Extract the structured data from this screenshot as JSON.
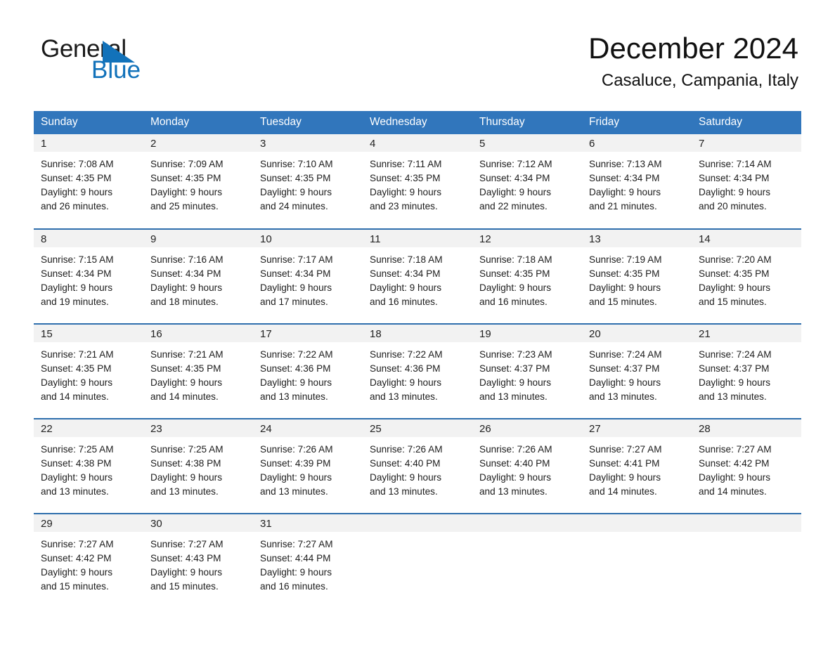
{
  "brand": {
    "name_part1": "General",
    "name_part2": "Blue",
    "logo_icon": "triangle-flag-icon",
    "accent_color": "#1272ba"
  },
  "header": {
    "title": "December 2024",
    "location": "Casaluce, Campania, Italy"
  },
  "theme": {
    "header_blue": "#3176bc",
    "row_divider_blue": "#2f6fad",
    "daynum_band": "#f2f2f2"
  },
  "weekday_headers": [
    "Sunday",
    "Monday",
    "Tuesday",
    "Wednesday",
    "Thursday",
    "Friday",
    "Saturday"
  ],
  "weeks": [
    [
      {
        "day": "1",
        "sunrise": "Sunrise: 7:08 AM",
        "sunset": "Sunset: 4:35 PM",
        "daylight1": "Daylight: 9 hours",
        "daylight2": "and 26 minutes."
      },
      {
        "day": "2",
        "sunrise": "Sunrise: 7:09 AM",
        "sunset": "Sunset: 4:35 PM",
        "daylight1": "Daylight: 9 hours",
        "daylight2": "and 25 minutes."
      },
      {
        "day": "3",
        "sunrise": "Sunrise: 7:10 AM",
        "sunset": "Sunset: 4:35 PM",
        "daylight1": "Daylight: 9 hours",
        "daylight2": "and 24 minutes."
      },
      {
        "day": "4",
        "sunrise": "Sunrise: 7:11 AM",
        "sunset": "Sunset: 4:35 PM",
        "daylight1": "Daylight: 9 hours",
        "daylight2": "and 23 minutes."
      },
      {
        "day": "5",
        "sunrise": "Sunrise: 7:12 AM",
        "sunset": "Sunset: 4:34 PM",
        "daylight1": "Daylight: 9 hours",
        "daylight2": "and 22 minutes."
      },
      {
        "day": "6",
        "sunrise": "Sunrise: 7:13 AM",
        "sunset": "Sunset: 4:34 PM",
        "daylight1": "Daylight: 9 hours",
        "daylight2": "and 21 minutes."
      },
      {
        "day": "7",
        "sunrise": "Sunrise: 7:14 AM",
        "sunset": "Sunset: 4:34 PM",
        "daylight1": "Daylight: 9 hours",
        "daylight2": "and 20 minutes."
      }
    ],
    [
      {
        "day": "8",
        "sunrise": "Sunrise: 7:15 AM",
        "sunset": "Sunset: 4:34 PM",
        "daylight1": "Daylight: 9 hours",
        "daylight2": "and 19 minutes."
      },
      {
        "day": "9",
        "sunrise": "Sunrise: 7:16 AM",
        "sunset": "Sunset: 4:34 PM",
        "daylight1": "Daylight: 9 hours",
        "daylight2": "and 18 minutes."
      },
      {
        "day": "10",
        "sunrise": "Sunrise: 7:17 AM",
        "sunset": "Sunset: 4:34 PM",
        "daylight1": "Daylight: 9 hours",
        "daylight2": "and 17 minutes."
      },
      {
        "day": "11",
        "sunrise": "Sunrise: 7:18 AM",
        "sunset": "Sunset: 4:34 PM",
        "daylight1": "Daylight: 9 hours",
        "daylight2": "and 16 minutes."
      },
      {
        "day": "12",
        "sunrise": "Sunrise: 7:18 AM",
        "sunset": "Sunset: 4:35 PM",
        "daylight1": "Daylight: 9 hours",
        "daylight2": "and 16 minutes."
      },
      {
        "day": "13",
        "sunrise": "Sunrise: 7:19 AM",
        "sunset": "Sunset: 4:35 PM",
        "daylight1": "Daylight: 9 hours",
        "daylight2": "and 15 minutes."
      },
      {
        "day": "14",
        "sunrise": "Sunrise: 7:20 AM",
        "sunset": "Sunset: 4:35 PM",
        "daylight1": "Daylight: 9 hours",
        "daylight2": "and 15 minutes."
      }
    ],
    [
      {
        "day": "15",
        "sunrise": "Sunrise: 7:21 AM",
        "sunset": "Sunset: 4:35 PM",
        "daylight1": "Daylight: 9 hours",
        "daylight2": "and 14 minutes."
      },
      {
        "day": "16",
        "sunrise": "Sunrise: 7:21 AM",
        "sunset": "Sunset: 4:35 PM",
        "daylight1": "Daylight: 9 hours",
        "daylight2": "and 14 minutes."
      },
      {
        "day": "17",
        "sunrise": "Sunrise: 7:22 AM",
        "sunset": "Sunset: 4:36 PM",
        "daylight1": "Daylight: 9 hours",
        "daylight2": "and 13 minutes."
      },
      {
        "day": "18",
        "sunrise": "Sunrise: 7:22 AM",
        "sunset": "Sunset: 4:36 PM",
        "daylight1": "Daylight: 9 hours",
        "daylight2": "and 13 minutes."
      },
      {
        "day": "19",
        "sunrise": "Sunrise: 7:23 AM",
        "sunset": "Sunset: 4:37 PM",
        "daylight1": "Daylight: 9 hours",
        "daylight2": "and 13 minutes."
      },
      {
        "day": "20",
        "sunrise": "Sunrise: 7:24 AM",
        "sunset": "Sunset: 4:37 PM",
        "daylight1": "Daylight: 9 hours",
        "daylight2": "and 13 minutes."
      },
      {
        "day": "21",
        "sunrise": "Sunrise: 7:24 AM",
        "sunset": "Sunset: 4:37 PM",
        "daylight1": "Daylight: 9 hours",
        "daylight2": "and 13 minutes."
      }
    ],
    [
      {
        "day": "22",
        "sunrise": "Sunrise: 7:25 AM",
        "sunset": "Sunset: 4:38 PM",
        "daylight1": "Daylight: 9 hours",
        "daylight2": "and 13 minutes."
      },
      {
        "day": "23",
        "sunrise": "Sunrise: 7:25 AM",
        "sunset": "Sunset: 4:38 PM",
        "daylight1": "Daylight: 9 hours",
        "daylight2": "and 13 minutes."
      },
      {
        "day": "24",
        "sunrise": "Sunrise: 7:26 AM",
        "sunset": "Sunset: 4:39 PM",
        "daylight1": "Daylight: 9 hours",
        "daylight2": "and 13 minutes."
      },
      {
        "day": "25",
        "sunrise": "Sunrise: 7:26 AM",
        "sunset": "Sunset: 4:40 PM",
        "daylight1": "Daylight: 9 hours",
        "daylight2": "and 13 minutes."
      },
      {
        "day": "26",
        "sunrise": "Sunrise: 7:26 AM",
        "sunset": "Sunset: 4:40 PM",
        "daylight1": "Daylight: 9 hours",
        "daylight2": "and 13 minutes."
      },
      {
        "day": "27",
        "sunrise": "Sunrise: 7:27 AM",
        "sunset": "Sunset: 4:41 PM",
        "daylight1": "Daylight: 9 hours",
        "daylight2": "and 14 minutes."
      },
      {
        "day": "28",
        "sunrise": "Sunrise: 7:27 AM",
        "sunset": "Sunset: 4:42 PM",
        "daylight1": "Daylight: 9 hours",
        "daylight2": "and 14 minutes."
      }
    ],
    [
      {
        "day": "29",
        "sunrise": "Sunrise: 7:27 AM",
        "sunset": "Sunset: 4:42 PM",
        "daylight1": "Daylight: 9 hours",
        "daylight2": "and 15 minutes."
      },
      {
        "day": "30",
        "sunrise": "Sunrise: 7:27 AM",
        "sunset": "Sunset: 4:43 PM",
        "daylight1": "Daylight: 9 hours",
        "daylight2": "and 15 minutes."
      },
      {
        "day": "31",
        "sunrise": "Sunrise: 7:27 AM",
        "sunset": "Sunset: 4:44 PM",
        "daylight1": "Daylight: 9 hours",
        "daylight2": "and 16 minutes."
      },
      {
        "day": "",
        "sunrise": "",
        "sunset": "",
        "daylight1": "",
        "daylight2": ""
      },
      {
        "day": "",
        "sunrise": "",
        "sunset": "",
        "daylight1": "",
        "daylight2": ""
      },
      {
        "day": "",
        "sunrise": "",
        "sunset": "",
        "daylight1": "",
        "daylight2": ""
      },
      {
        "day": "",
        "sunrise": "",
        "sunset": "",
        "daylight1": "",
        "daylight2": ""
      }
    ]
  ]
}
